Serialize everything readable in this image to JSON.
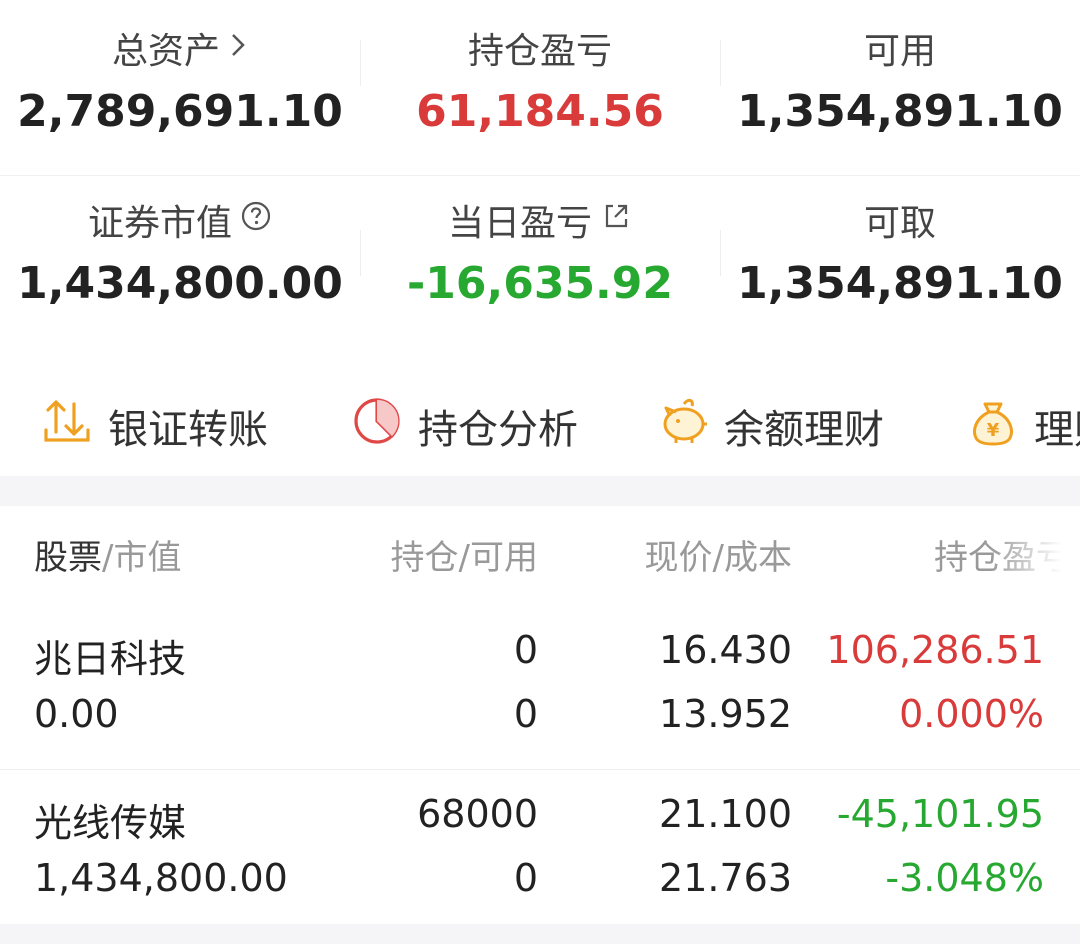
{
  "summary": {
    "total_assets_label": "总资产",
    "total_assets_value": "2,789,691.10",
    "position_pl_label": "持仓盈亏",
    "position_pl_value": "61,184.56",
    "available_label": "可用",
    "available_value": "1,354,891.10",
    "market_value_label": "证券市值",
    "market_value_value": "1,434,800.00",
    "daily_pl_label": "当日盈亏",
    "daily_pl_value": "-16,635.92",
    "withdrawable_label": "可取",
    "withdrawable_value": "1,354,891.10"
  },
  "quick_actions": [
    {
      "label": "银证转账",
      "icon": "transfer-icon"
    },
    {
      "label": "持仓分析",
      "icon": "pie-chart-icon"
    },
    {
      "label": "余额理财",
      "icon": "piggy-bank-icon"
    },
    {
      "label": "理财",
      "icon": "money-bag-icon"
    }
  ],
  "table": {
    "headers": {
      "stock": "股票",
      "market_value": "市值",
      "hold": "持仓",
      "available": "可用",
      "price": "现价",
      "cost": "成本",
      "pl": "持仓盈亏"
    },
    "rows": [
      {
        "name": "兆日科技",
        "market_value": "0.00",
        "hold": "0",
        "available": "0",
        "price": "16.430",
        "cost": "13.952",
        "pl": "106,286.51",
        "pl_pct": "0.000%",
        "trend": "up"
      },
      {
        "name": "光线传媒",
        "market_value": "1,434,800.00",
        "hold": "68000",
        "available": "0",
        "price": "21.100",
        "cost": "21.763",
        "pl": "-45,101.95",
        "pl_pct": "-3.048%",
        "trend": "down"
      }
    ]
  },
  "colors": {
    "up": "#d93a3a",
    "down": "#27a830",
    "accent": "#f0a020"
  }
}
